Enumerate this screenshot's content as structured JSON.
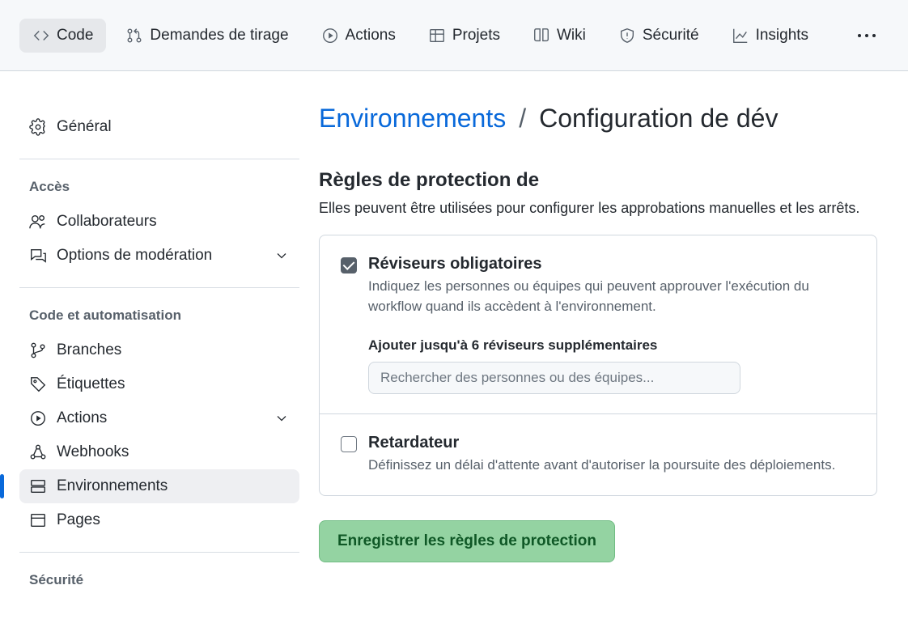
{
  "tabs": {
    "code": "Code",
    "pull_requests": "Demandes de tirage",
    "actions": "Actions",
    "projects": "Projets",
    "wiki": "Wiki",
    "security": "Sécurité",
    "insights": "Insights"
  },
  "sidebar": {
    "general": "Général",
    "access_heading": "Accès",
    "collaborators": "Collaborateurs",
    "moderation": "Options de modération",
    "code_auto_heading": "Code et automatisation",
    "branches": "Branches",
    "tags": "Étiquettes",
    "actions": "Actions",
    "webhooks": "Webhooks",
    "environments": "Environnements",
    "pages": "Pages",
    "security_heading": "Sécurité"
  },
  "breadcrumb": {
    "parent": "Environnements",
    "current": "Configuration de dév"
  },
  "rules": {
    "section_title": "Règles de protection de",
    "section_desc": "Elles peuvent être utilisées pour configurer les approbations manuelles et les arrêts.",
    "required_reviewers": {
      "title": "Réviseurs obligatoires",
      "desc": "Indiquez les personnes ou équipes qui peuvent approuver l'exécution du workflow quand ils accèdent à l'environnement.",
      "checked": true,
      "add_label": "Ajouter jusqu'à 6 réviseurs supplémentaires",
      "search_placeholder": "Rechercher des personnes ou des équipes..."
    },
    "wait_timer": {
      "title": "Retardateur",
      "desc": "Définissez un délai d'attente avant d'autoriser la poursuite des déploiements.",
      "checked": false
    },
    "save_button": "Enregistrer les règles de protection"
  }
}
